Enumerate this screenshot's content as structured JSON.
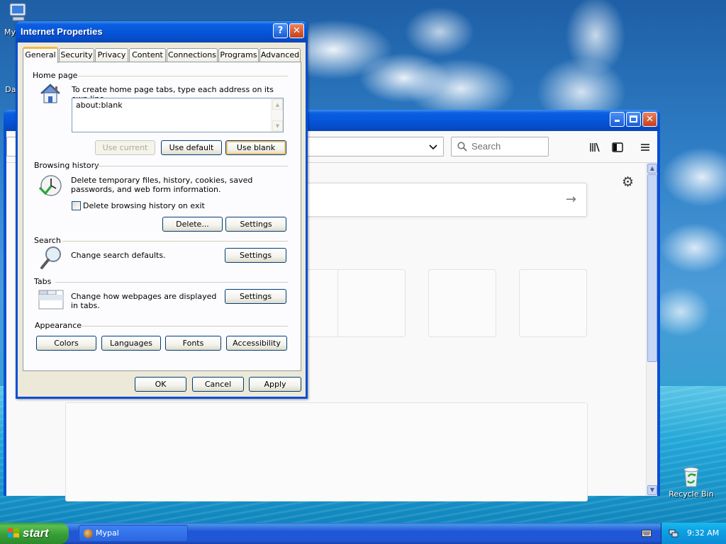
{
  "desktop": {
    "icons": [
      {
        "label": "My"
      },
      {
        "label": "Dat"
      },
      {
        "label": "Recycle Bin"
      }
    ]
  },
  "browser": {
    "search_placeholder": "Search"
  },
  "dialog": {
    "title": "Internet Properties",
    "help_label": "?",
    "close_label": "✕",
    "tabs": [
      {
        "label": "General"
      },
      {
        "label": "Security"
      },
      {
        "label": "Privacy"
      },
      {
        "label": "Content"
      },
      {
        "label": "Connections"
      },
      {
        "label": "Programs"
      },
      {
        "label": "Advanced"
      }
    ],
    "homepage": {
      "group_label": "Home page",
      "description": "To create home page tabs, type each address on its own line.",
      "value": "about:blank",
      "use_current": "Use current",
      "use_default": "Use default",
      "use_blank": "Use blank"
    },
    "history": {
      "group_label": "Browsing history",
      "description": "Delete temporary files, history, cookies, saved passwords, and web form information.",
      "checkbox_label": "Delete browsing history on exit",
      "delete_button": "Delete...",
      "settings_button": "Settings"
    },
    "search": {
      "group_label": "Search",
      "description": "Change search defaults.",
      "settings_button": "Settings"
    },
    "tabs_section": {
      "group_label": "Tabs",
      "description": "Change how webpages are displayed in tabs.",
      "settings_button": "Settings"
    },
    "appearance": {
      "group_label": "Appearance",
      "colors_button": "Colors",
      "languages_button": "Languages",
      "fonts_button": "Fonts",
      "accessibility_button": "Accessibility"
    },
    "footer": {
      "ok": "OK",
      "cancel": "Cancel",
      "apply": "Apply"
    }
  },
  "taskbar": {
    "start_label": "start",
    "tasks": [
      {
        "label": "Mypal"
      }
    ],
    "clock": "9:32 AM"
  }
}
